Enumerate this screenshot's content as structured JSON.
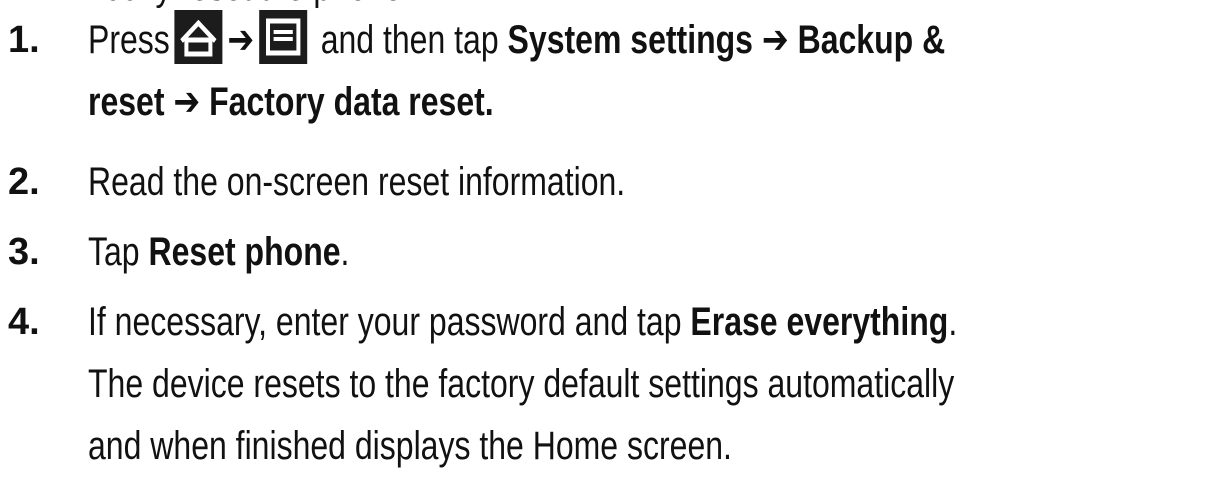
{
  "top_fragment": "nually reset the phone:",
  "steps": [
    {
      "number": "1.",
      "press": "Press",
      "arrow1": "➔",
      "and_then": "and then tap",
      "system_settings": "System settings",
      "arrow2": "➔",
      "backup": "Backup &",
      "reset": "reset",
      "arrow3": "➔",
      "factory_reset": "Factory data reset.",
      "home_icon": "home-icon",
      "menu_icon": "menu-icon"
    },
    {
      "number": "2.",
      "text": "Read the on-screen reset information."
    },
    {
      "number": "3.",
      "tap": "Tap",
      "reset_phone": "Reset phone",
      "period": "."
    },
    {
      "number": "4.",
      "text_a": "If necessary, enter your password and tap",
      "erase_everything": "Erase everything",
      "period": ".",
      "line2": "The device resets to the factory default settings automatically",
      "line3": "and when finished displays the Home screen."
    }
  ]
}
